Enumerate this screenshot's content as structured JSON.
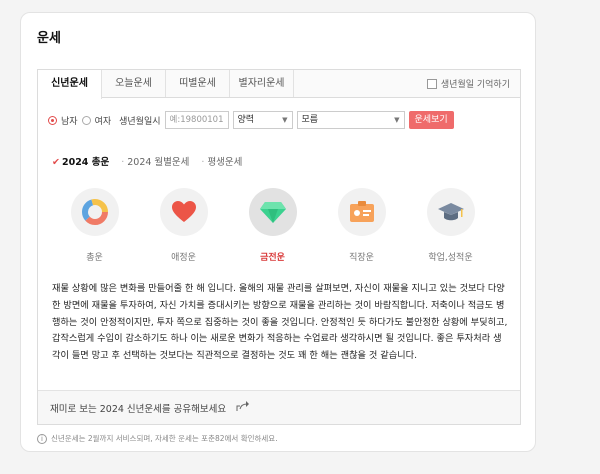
{
  "card": {
    "title": "운세"
  },
  "tabs": [
    {
      "label": "신년운세",
      "active": true
    },
    {
      "label": "오늘운세",
      "active": false
    },
    {
      "label": "띠별운세",
      "active": false
    },
    {
      "label": "별자리운세",
      "active": false
    }
  ],
  "remember": {
    "label": "생년월일 기억하기",
    "checked": false
  },
  "form": {
    "male_label": "남자",
    "female_label": "여자",
    "selected_gender": "male",
    "birth_label": "생년월일시",
    "birth_placeholder": "예:19800101",
    "calendar_value": "양력",
    "time_value": "모름",
    "submit_label": "운세보기"
  },
  "subtabs": [
    {
      "label": "2024 총운",
      "active": true
    },
    {
      "label": "2024 월별운세",
      "active": false
    },
    {
      "label": "평생운세",
      "active": false
    }
  ],
  "categories": [
    {
      "label": "총운",
      "icon": "pie-chart-icon",
      "selected": false
    },
    {
      "label": "애정운",
      "icon": "heart-icon",
      "selected": false
    },
    {
      "label": "금전운",
      "icon": "gem-icon",
      "selected": true
    },
    {
      "label": "직장운",
      "icon": "id-badge-icon",
      "selected": false
    },
    {
      "label": "학업,성적운",
      "icon": "graduation-cap-icon",
      "selected": false
    }
  ],
  "description": "재물 상황에 많은 변화를 만들어줄 한 해 입니다. 올해의 재물 관리를 살펴보면, 자신이 재물을 지니고 있는 것보다 다양한 방면에 재물을 투자하여, 자신 가치를 증대시키는 방향으로 재물을 관리하는 것이 바람직합니다. 저축이나 적금도 병행하는 것이 안정적이지만, 투자 쪽으로 집중하는 것이 좋을 것입니다. 안정적인 듯 하다가도 불안정한 상황에 부딪히고, 갑작스럽게 수입이 감소하기도 하나 이는 새로운 변화가 적응하는 수업료라 생각하시면 될 것입니다. 좋은 투자처라 생각이 들면 망고 후 선택하는 것보다는 직관적으로 결정하는 것도 꽤 한 해는 괜찮을 것 같습니다.",
  "share": {
    "label": "재미로 보는 2024 신년운세를 공유해보세요"
  },
  "footnote": {
    "text": "신년운세는 2월까지 서비스되며, 자세한 운세는 포춘82에서 확인하세요."
  },
  "colors": {
    "accent": "#e24b4b",
    "button": "#ef6b6b"
  }
}
